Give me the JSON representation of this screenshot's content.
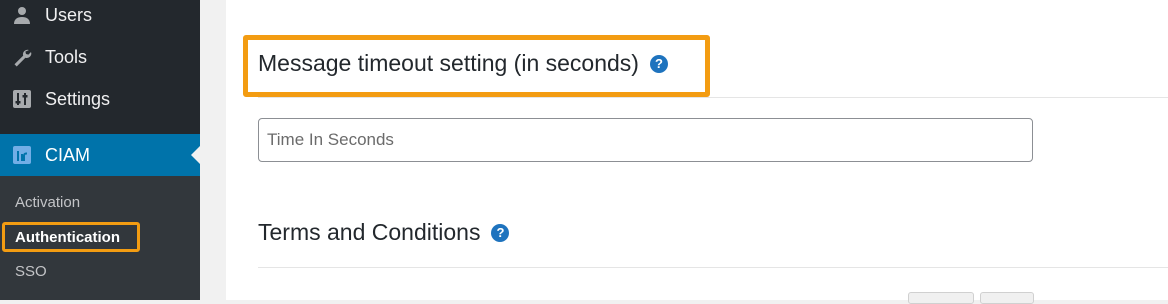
{
  "sidebar": {
    "menu": [
      {
        "label": "Users",
        "icon": "users-icon"
      },
      {
        "label": "Tools",
        "icon": "wrench-icon"
      },
      {
        "label": "Settings",
        "icon": "settings-icon"
      },
      {
        "label": "CIAM",
        "icon": "ciam-icon"
      }
    ],
    "submenu": [
      {
        "label": "Activation"
      },
      {
        "label": "Authentication"
      },
      {
        "label": "SSO"
      }
    ]
  },
  "main": {
    "timeout_title": "Message timeout setting (in seconds)",
    "timeout_input": {
      "placeholder": "Time In Seconds",
      "value": ""
    },
    "terms_title": "Terms and Conditions",
    "help_glyph": "?"
  },
  "colors": {
    "sidebar_bg": "#23282d",
    "submenu_bg": "#32373c",
    "active_blue": "#0073aa",
    "highlight_orange": "#f39c12",
    "help_blue": "#1e73be"
  }
}
